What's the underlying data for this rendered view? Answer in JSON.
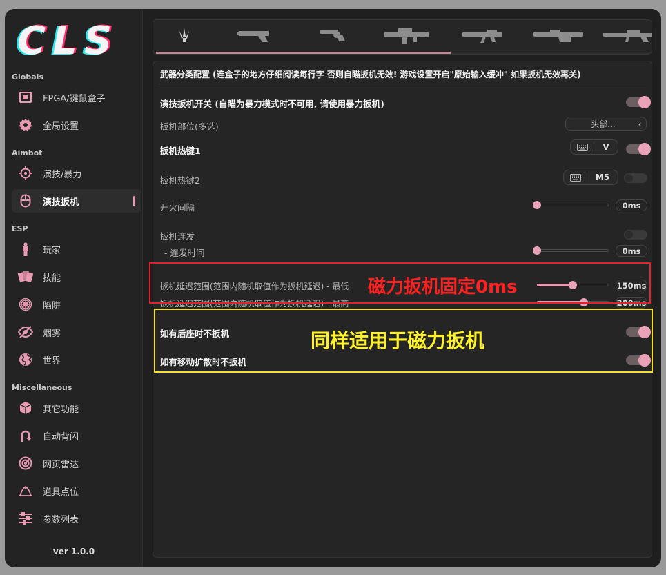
{
  "logo": {
    "text": "CLS"
  },
  "sidebar": {
    "sections": [
      {
        "title": "Globals",
        "items": [
          {
            "label": "FPGA/键鼠盒子",
            "icon": "fpga-board-icon"
          },
          {
            "label": "全局设置",
            "icon": "gear-icon"
          }
        ]
      },
      {
        "title": "Aimbot",
        "items": [
          {
            "label": "演技/暴力",
            "icon": "crosshair-icon"
          },
          {
            "label": "演技扳机",
            "icon": "mouse-icon",
            "active": true
          }
        ]
      },
      {
        "title": "ESP",
        "items": [
          {
            "label": "玩家",
            "icon": "person-icon"
          },
          {
            "label": "技能",
            "icon": "cards-icon"
          },
          {
            "label": "陷阱",
            "icon": "spiderweb-icon"
          },
          {
            "label": "烟雾",
            "icon": "eye-slash-icon"
          },
          {
            "label": "世界",
            "icon": "globe-icon"
          }
        ]
      },
      {
        "title": "Miscellaneous",
        "items": [
          {
            "label": "其它功能",
            "icon": "cube-icon"
          },
          {
            "label": "自动背闪",
            "icon": "u-turn-icon"
          },
          {
            "label": "网页雷达",
            "icon": "radar-icon"
          },
          {
            "label": "道具点位",
            "icon": "map-marker-icon"
          },
          {
            "label": "参数列表",
            "icon": "sliders-icon"
          }
        ]
      }
    ],
    "version": "ver 1.0.0"
  },
  "weapon_tabs": [
    "knife-icon",
    "pistol-icon",
    "revolver-icon",
    "smg-icon",
    "rifle-icon",
    "shotgun-icon",
    "sniper-icon"
  ],
  "panel": {
    "title": "武器分类配置 (连盒子的地方仔细阅读每行字 否则自瞄扳机无效!  游戏设置开启\"原始输入缓冲\" 如果扳机无效再关)",
    "rows": {
      "trigger_switch": {
        "label": "演技扳机开关 (自瞄为暴力模式时不可用, 请使用暴力扳机)",
        "on": true
      },
      "trigger_part": {
        "label": "扳机部位(多选)",
        "value": "头部..."
      },
      "hotkey1": {
        "label": "扳机热键1",
        "key": "V",
        "on": true
      },
      "hotkey2": {
        "label": "扳机热键2",
        "key": "M5",
        "on": false
      },
      "fire_interval": {
        "label": "开火间隔",
        "value": "0ms",
        "fraction": 0.0
      },
      "burst": {
        "label": "扳机连发",
        "on": false
      },
      "burst_time": {
        "label": "- 连发时间",
        "value": "0ms",
        "fraction": 0.0
      },
      "delay_min": {
        "label": "扳机延迟范围(范围内随机取值作为扳机延迟) - 最低",
        "value": "150ms",
        "fraction": 0.5
      },
      "delay_max": {
        "label": "扳机延迟范围(范围内随机取值作为扳机延迟) - 最高",
        "value": "200ms",
        "fraction": 0.65
      },
      "no_recoil": {
        "label": "如有后座时不扳机",
        "on": true
      },
      "no_spread": {
        "label": "如有移动扩散时不扳机",
        "on": true
      }
    }
  },
  "annotations": {
    "red_note": "磁力扳机固定0ms",
    "yellow_note": "同样适用于磁力扳机"
  },
  "colors": {
    "accent": "#e79ab2",
    "red_note": "#ff2222",
    "yellow_note": "#fff22a"
  }
}
